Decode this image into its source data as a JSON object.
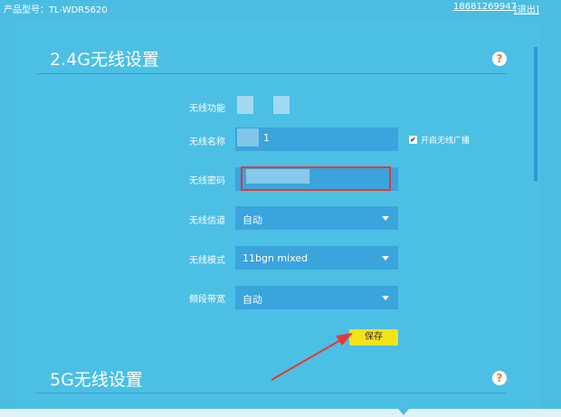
{
  "header": {
    "model": "产品型号：TL-WDR5620",
    "phone": "18681269947",
    "logout": "[退出]"
  },
  "wifi24": {
    "title": "2.4G无线设置",
    "help": "?",
    "labels": {
      "function": "无线功能",
      "name": "无线名称",
      "password": "无线密码",
      "channel": "无线信道",
      "mode": "无线模式",
      "bandwidth": "频段带宽"
    },
    "ssid_visible": "1",
    "broadcast_label": "开启无线广播",
    "broadcast_checked": "✔",
    "channel_value": "自动",
    "mode_value": "11bgn mixed",
    "bandwidth_value": "自动",
    "save_label": "保存"
  },
  "wifi5": {
    "title": "5G无线设置",
    "help": "?"
  },
  "colors": {
    "background": "#4bbde3",
    "field": "#3aa4dc",
    "save": "#f4e21b",
    "highlight": "#e53935"
  }
}
